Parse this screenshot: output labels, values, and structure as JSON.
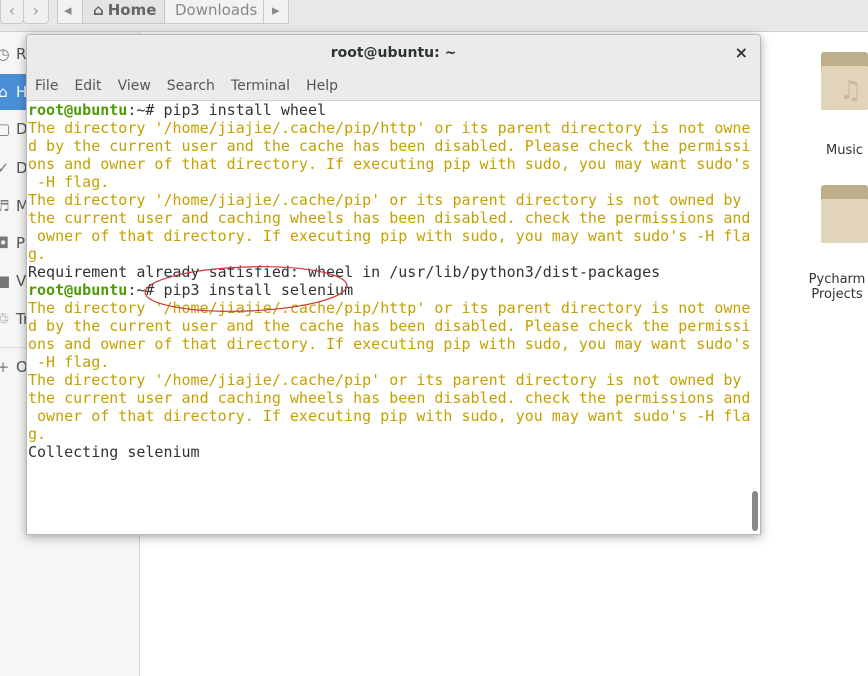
{
  "files": {
    "nav_back": "‹",
    "nav_forward": "›",
    "crumb_left": "◂",
    "crumb_right": "▸",
    "breadcrumb": [
      "Home",
      "Downloads"
    ],
    "sidebar": [
      {
        "label": "Recent",
        "icon": "clock-icon"
      },
      {
        "label": "Home",
        "icon": "home-icon",
        "selected": true
      },
      {
        "label": "Documents",
        "icon": "document-icon"
      },
      {
        "label": "Downloads",
        "icon": "download-icon"
      },
      {
        "label": "Music",
        "icon": "music-icon"
      },
      {
        "label": "Pictures",
        "icon": "camera-icon"
      },
      {
        "label": "Videos",
        "icon": "video-icon"
      },
      {
        "label": "Trash",
        "icon": "trash-icon"
      },
      {
        "label": "Other Locations",
        "icon": "plus-icon"
      }
    ],
    "folders": [
      "Music",
      "PycharmProjects"
    ]
  },
  "terminal": {
    "title": "root@ubuntu: ~",
    "close": "×",
    "menu": [
      "File",
      "Edit",
      "View",
      "Search",
      "Terminal",
      "Help"
    ],
    "prompt": "root@ubuntu",
    "prompt_suffix": ":~# ",
    "lines": [
      {
        "type": "cmd",
        "text": "pip3 install wheel"
      },
      {
        "type": "warn",
        "text": "The directory '/home/jiajie/.cache/pip/http' or its parent directory is not owne"
      },
      {
        "type": "warn",
        "text": "d by the current user and the cache has been disabled. Please check the permissi"
      },
      {
        "type": "warn",
        "text": "ons and owner of that directory. If executing pip with sudo, you may want sudo's"
      },
      {
        "type": "warn",
        "text": " -H flag."
      },
      {
        "type": "warn",
        "text": "The directory '/home/jiajie/.cache/pip' or its parent directory is not owned by"
      },
      {
        "type": "warn",
        "text": "the current user and caching wheels has been disabled. check the permissions and"
      },
      {
        "type": "warn",
        "text": " owner of that directory. If executing pip with sudo, you may want sudo's -H fla"
      },
      {
        "type": "warn",
        "text": "g."
      },
      {
        "type": "out",
        "text": "Requirement already satisfied: wheel in /usr/lib/python3/dist-packages"
      },
      {
        "type": "cmd",
        "text": "pip3 install selenium"
      },
      {
        "type": "warn",
        "text": "The directory '/home/jiajie/.cache/pip/http' or its parent directory is not owne"
      },
      {
        "type": "warn",
        "text": "d by the current user and the cache has been disabled. Please check the permissi"
      },
      {
        "type": "warn",
        "text": "ons and owner of that directory. If executing pip with sudo, you may want sudo's"
      },
      {
        "type": "warn",
        "text": " -H flag."
      },
      {
        "type": "warn",
        "text": "The directory '/home/jiajie/.cache/pip' or its parent directory is not owned by"
      },
      {
        "type": "warn",
        "text": "the current user and caching wheels has been disabled. check the permissions and"
      },
      {
        "type": "warn",
        "text": " owner of that directory. If executing pip with sudo, you may want sudo's -H fla"
      },
      {
        "type": "warn",
        "text": "g."
      },
      {
        "type": "out",
        "text": "Collecting selenium"
      }
    ]
  },
  "colors": {
    "prompt": "#4e9a06",
    "warning": "#c4a000",
    "selection": "#4a90d9",
    "annotation": "#d0343a"
  }
}
